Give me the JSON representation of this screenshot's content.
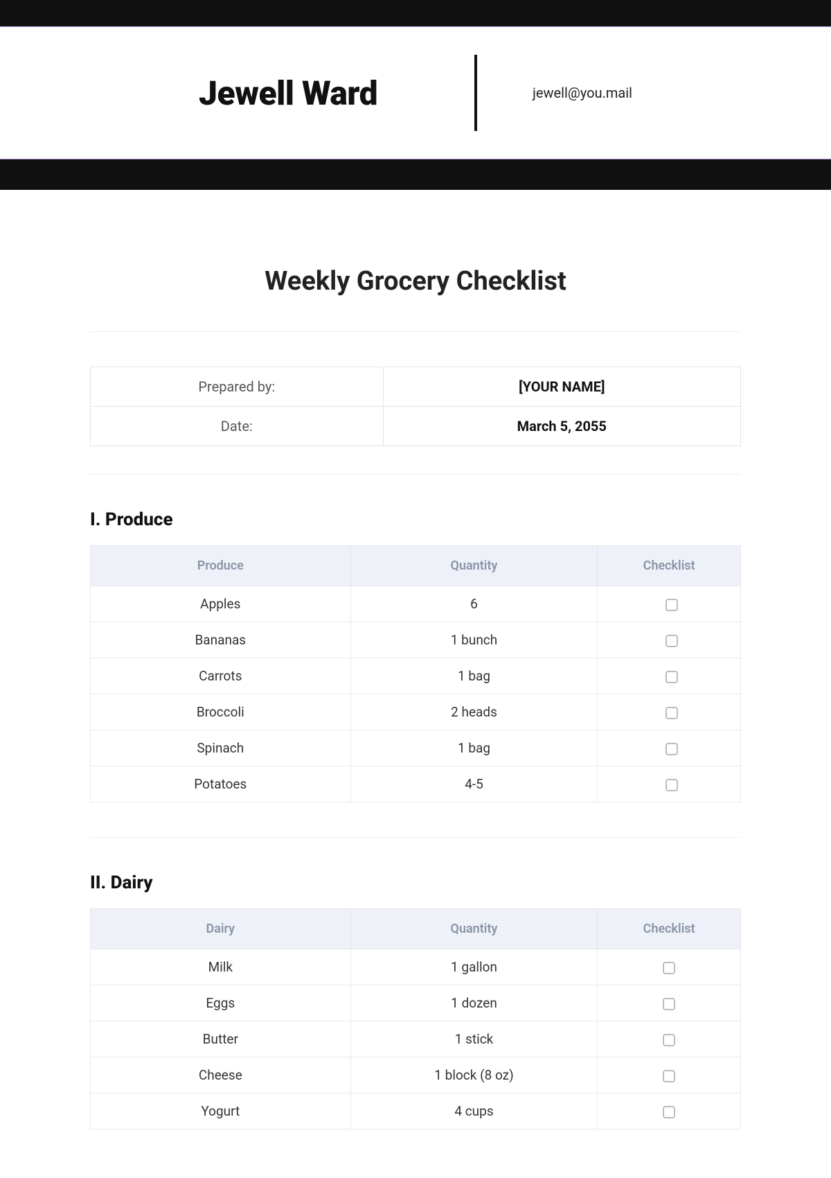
{
  "header": {
    "name": "Jewell Ward",
    "email": "jewell@you.mail"
  },
  "document": {
    "title": "Weekly Grocery Checklist"
  },
  "meta": {
    "prepared_by_label": "Prepared by:",
    "prepared_by_value": "[YOUR NAME]",
    "date_label": "Date:",
    "date_value": "March 5, 2055"
  },
  "sections": {
    "produce": {
      "heading": "I. Produce",
      "columns": {
        "item": "Produce",
        "qty": "Quantity",
        "chk": "Checklist"
      },
      "rows": [
        {
          "item": "Apples",
          "qty": "6"
        },
        {
          "item": "Bananas",
          "qty": "1 bunch"
        },
        {
          "item": "Carrots",
          "qty": "1 bag"
        },
        {
          "item": "Broccoli",
          "qty": "2 heads"
        },
        {
          "item": "Spinach",
          "qty": "1 bag"
        },
        {
          "item": "Potatoes",
          "qty": "4-5"
        }
      ]
    },
    "dairy": {
      "heading": "II. Dairy",
      "columns": {
        "item": "Dairy",
        "qty": "Quantity",
        "chk": "Checklist"
      },
      "rows": [
        {
          "item": "Milk",
          "qty": "1 gallon"
        },
        {
          "item": "Eggs",
          "qty": "1 dozen"
        },
        {
          "item": "Butter",
          "qty": "1 stick"
        },
        {
          "item": "Cheese",
          "qty": "1 block (8 oz)"
        },
        {
          "item": "Yogurt",
          "qty": "4 cups"
        }
      ]
    }
  }
}
